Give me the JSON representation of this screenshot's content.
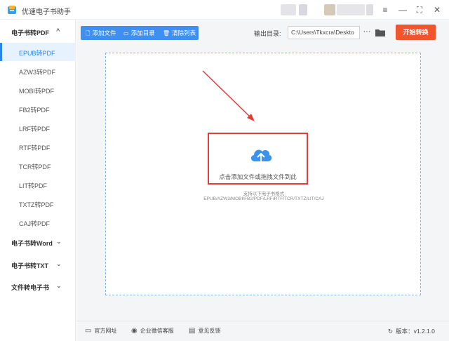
{
  "app": {
    "title": "优速电子书助手"
  },
  "window_controls": {
    "menu": "≡",
    "minimize": "—",
    "maximize": "⛶",
    "close": "✕"
  },
  "sidebar": {
    "groups": [
      {
        "label": "电子书转PDF",
        "chevron": "^",
        "expanded": true
      },
      {
        "label": "电子书转Word",
        "chevron": "⌄",
        "expanded": false
      },
      {
        "label": "电子书转TXT",
        "chevron": "⌄",
        "expanded": false
      },
      {
        "label": "文件转电子书",
        "chevron": "⌄",
        "expanded": false
      }
    ],
    "items": [
      {
        "label": "EPUB转PDF",
        "active": true
      },
      {
        "label": "AZW3转PDF"
      },
      {
        "label": "MOBI转PDF"
      },
      {
        "label": "FB2转PDF"
      },
      {
        "label": "LRF转PDF"
      },
      {
        "label": "RTF转PDF"
      },
      {
        "label": "TCR转PDF"
      },
      {
        "label": "LIT转PDF"
      },
      {
        "label": "TXTZ转PDF"
      },
      {
        "label": "CAJ转PDF"
      }
    ]
  },
  "toolbar": {
    "add_file": "添加文件",
    "add_folder": "添加目录",
    "clear_list": "清除列表",
    "output_label": "输出目录:",
    "output_path": "C:\\Users\\Tkxcra\\Deskto",
    "more": "···",
    "start": "开始转换"
  },
  "dropzone": {
    "upload_text": "点击添加文件或拖拽文件到此",
    "formats_head": "支持以下电子书格式",
    "formats_list": "EPUB/AZW3/MOBI/FB2/PDF/LRF/RTF/TCR/TXTZ/LIT/CAJ"
  },
  "footer": {
    "website": "官方网址",
    "wechat": "企业微信客服",
    "feedback": "意见反馈",
    "version": "版本：v1.2.1.0"
  },
  "colors": {
    "accent": "#2a86e6",
    "toolbar": "#3d8ff0",
    "start": "#f2542d",
    "highlight": "#e23d3d"
  }
}
